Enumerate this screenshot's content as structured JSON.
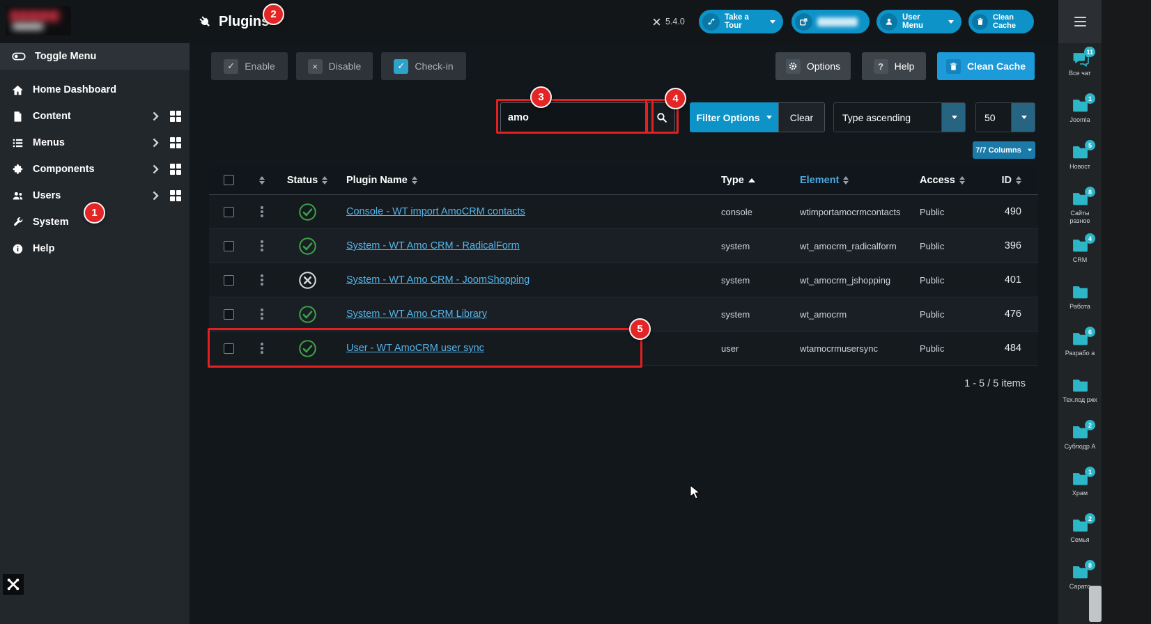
{
  "app": {
    "title": "Plugins",
    "version": "5.4.0"
  },
  "header": {
    "tour_label": "Take a Tour",
    "user_menu_label": "User Menu",
    "clean_cache_label": "Clean Cache"
  },
  "sidebar": {
    "toggle_label": "Toggle Menu",
    "items": [
      {
        "label": "Home Dashboard",
        "icon": "home-icon",
        "has_children": false
      },
      {
        "label": "Content",
        "icon": "document-icon",
        "has_children": true
      },
      {
        "label": "Menus",
        "icon": "list-icon",
        "has_children": true
      },
      {
        "label": "Components",
        "icon": "puzzle-icon",
        "has_children": true
      },
      {
        "label": "Users",
        "icon": "users-icon",
        "has_children": true
      },
      {
        "label": "System",
        "icon": "wrench-icon",
        "has_children": false
      },
      {
        "label": "Help",
        "icon": "info-icon",
        "has_children": false
      }
    ]
  },
  "toolbar": {
    "enable_label": "Enable",
    "disable_label": "Disable",
    "checkin_label": "Check-in",
    "options_label": "Options",
    "help_label": "Help",
    "clean_cache_label": "Clean Cache"
  },
  "filters": {
    "search_value": "amo",
    "filter_options_label": "Filter Options",
    "clear_label": "Clear",
    "sort_value": "Type ascending",
    "limit_value": "50",
    "columns_label": "7/7 Columns"
  },
  "table": {
    "headers": {
      "status": "Status",
      "name": "Plugin Name",
      "type": "Type",
      "element": "Element",
      "access": "Access",
      "id": "ID"
    },
    "rows": [
      {
        "name": "Console - WT import AmoCRM contacts",
        "status": "enabled",
        "type": "console",
        "element": "wtimportamocrmcontacts",
        "access": "Public",
        "id": "490"
      },
      {
        "name": "System - WT Amo CRM - RadicalForm",
        "status": "enabled",
        "type": "system",
        "element": "wt_amocrm_radicalform",
        "access": "Public",
        "id": "396"
      },
      {
        "name": "System - WT Amo CRM - JoomShopping",
        "status": "disabled",
        "type": "system",
        "element": "wt_amocrm_jshopping",
        "access": "Public",
        "id": "401"
      },
      {
        "name": "System - WT Amo CRM Library",
        "status": "enabled",
        "type": "system",
        "element": "wt_amocrm",
        "access": "Public",
        "id": "476"
      },
      {
        "name": "User - WT AmoCRM user sync",
        "status": "enabled",
        "type": "user",
        "element": "wtamocrmusersync",
        "access": "Public",
        "id": "484"
      }
    ],
    "pagination": "1 - 5 / 5 items"
  },
  "chat_panel": {
    "items": [
      {
        "label": "Все чат",
        "badge": "11"
      },
      {
        "label": "Joomla",
        "badge": "1"
      },
      {
        "label": "Новост",
        "badge": "5"
      },
      {
        "label": "Сайты разное",
        "badge": "8"
      },
      {
        "label": "CRM",
        "badge": "4"
      },
      {
        "label": "Работа",
        "badge": ""
      },
      {
        "label": "Разрабо а",
        "badge": "6"
      },
      {
        "label": "Тех.под ржк",
        "badge": ""
      },
      {
        "label": "Субподр А",
        "badge": "2"
      },
      {
        "label": "Храм",
        "badge": "1"
      },
      {
        "label": "Семья",
        "badge": "2"
      },
      {
        "label": "Сарато",
        "badge": "8"
      }
    ]
  },
  "annotations": {
    "n1": "1",
    "n2": "2",
    "n3": "3",
    "n4": "4",
    "n5": "5"
  },
  "colors": {
    "accent": "#0e93c9",
    "panel_teal": "#2db6c8",
    "annotation_red": "#e32525",
    "status_green": "#3fa14a",
    "link_blue": "#54b4ea"
  }
}
